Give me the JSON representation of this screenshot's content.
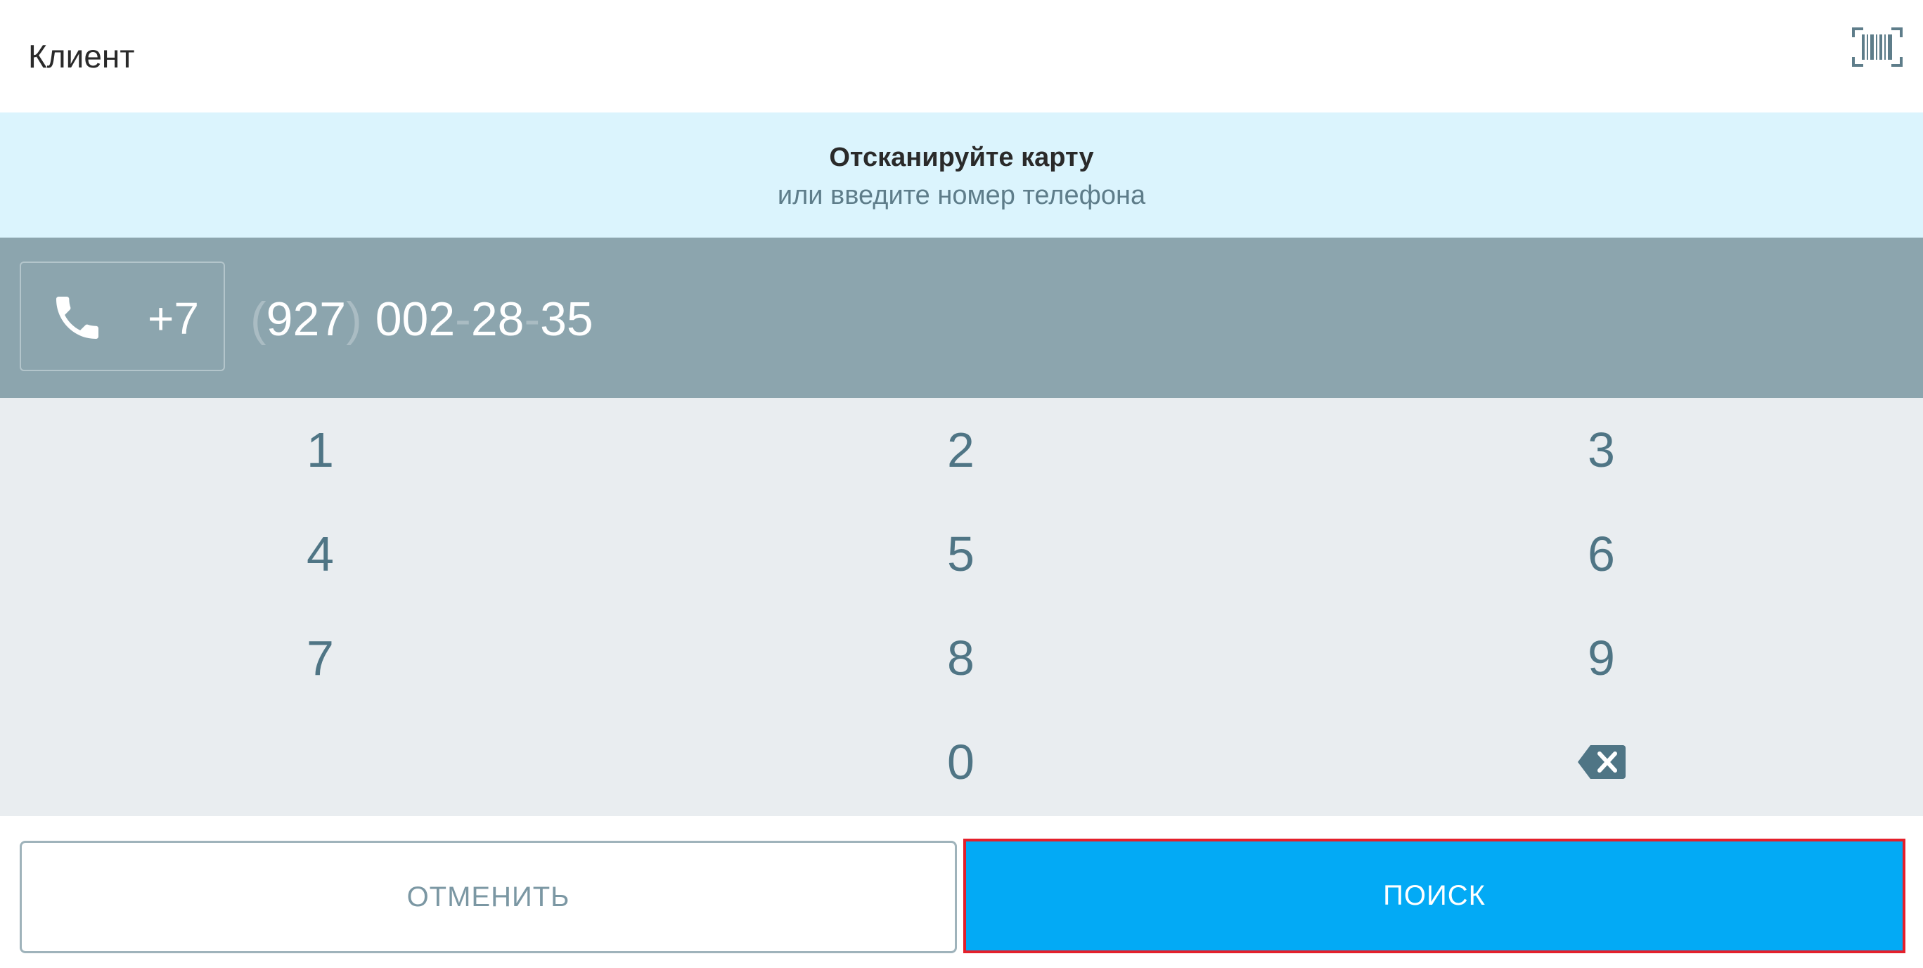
{
  "header": {
    "title": "Клиент",
    "barcode_icon": "barcode-scan-icon"
  },
  "banner": {
    "title": "Отсканируйте карту",
    "subtitle": "или введите номер телефона"
  },
  "phone": {
    "icon": "phone-icon",
    "country_code": "+7",
    "open_paren": "(",
    "area_code": "927",
    "close_paren": ")",
    "part1": "002",
    "dash1": "-",
    "part2": "28",
    "dash2": "-",
    "part3": "35"
  },
  "keypad": {
    "keys": [
      "1",
      "2",
      "3",
      "4",
      "5",
      "6",
      "7",
      "8",
      "9",
      "0"
    ],
    "backspace_icon": "backspace-icon"
  },
  "buttons": {
    "cancel_label": "ОТМЕНИТЬ",
    "search_label": "ПОИСК"
  },
  "colors": {
    "accent": "#03aaf5",
    "highlight_border": "#e4202b",
    "phone_bar": "#8ca5ae",
    "banner_bg": "#dbf4fd",
    "keypad_bg": "#e9edf0",
    "key_text": "#4f7585"
  }
}
